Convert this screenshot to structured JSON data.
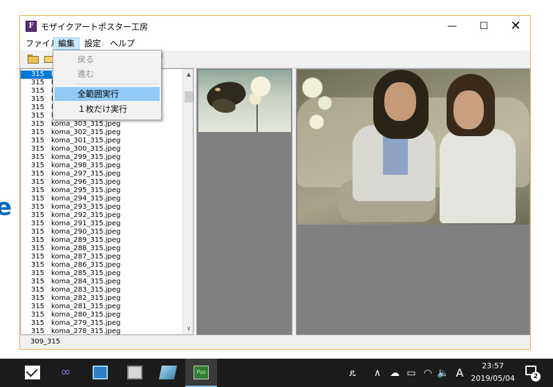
{
  "window": {
    "title": "モザイクアートポスター工房",
    "minimize_glyph": "—",
    "maximize_glyph": "☐",
    "close_glyph": "✕"
  },
  "menubar": {
    "items": [
      {
        "label": "ファイル"
      },
      {
        "label": "編集"
      },
      {
        "label": "設定"
      },
      {
        "label": "ヘルプ"
      }
    ]
  },
  "toolbar": {
    "help_glyph": "?"
  },
  "edit_menu": {
    "items": [
      {
        "label": "戻る",
        "enabled": false
      },
      {
        "label": "進む",
        "enabled": false
      },
      {
        "label": "全範囲実行",
        "enabled": true,
        "highlighted": true
      },
      {
        "label": "１枚だけ実行",
        "enabled": true
      }
    ]
  },
  "file_list": {
    "rows": [
      {
        "num": "315",
        "name": "k"
      },
      {
        "num": "315",
        "name": "k"
      },
      {
        "num": "315",
        "name": "k"
      },
      {
        "num": "315",
        "name": "k"
      },
      {
        "num": "315",
        "name": "k"
      },
      {
        "num": "315",
        "name": "k"
      },
      {
        "num": "315",
        "name": "koma_303_315.jpeg"
      },
      {
        "num": "315",
        "name": "koma_302_315.jpeg"
      },
      {
        "num": "315",
        "name": "koma_301_315.jpeg"
      },
      {
        "num": "315",
        "name": "koma_300_315.jpeg"
      },
      {
        "num": "315",
        "name": "koma_299_315.jpeg"
      },
      {
        "num": "315",
        "name": "koma_298_315.jpeg"
      },
      {
        "num": "315",
        "name": "koma_297_315.jpeg"
      },
      {
        "num": "315",
        "name": "koma_296_315.jpeg"
      },
      {
        "num": "315",
        "name": "koma_295_315.jpeg"
      },
      {
        "num": "315",
        "name": "koma_294_315.jpeg"
      },
      {
        "num": "315",
        "name": "koma_293_315.jpeg"
      },
      {
        "num": "315",
        "name": "koma_292_315.jpeg"
      },
      {
        "num": "315",
        "name": "koma_291_315.jpeg"
      },
      {
        "num": "315",
        "name": "koma_290_315.jpeg"
      },
      {
        "num": "315",
        "name": "koma_289_315.jpeg"
      },
      {
        "num": "315",
        "name": "koma_288_315.jpeg"
      },
      {
        "num": "315",
        "name": "koma_287_315.jpeg"
      },
      {
        "num": "315",
        "name": "koma_286_315.jpeg"
      },
      {
        "num": "315",
        "name": "koma_285_315.jpeg"
      },
      {
        "num": "315",
        "name": "koma_284_315.jpeg"
      },
      {
        "num": "315",
        "name": "koma_283_315.jpeg"
      },
      {
        "num": "315",
        "name": "koma_282_315.jpeg"
      },
      {
        "num": "315",
        "name": "koma_281_315.jpeg"
      },
      {
        "num": "315",
        "name": "koma_280_315.jpeg"
      },
      {
        "num": "315",
        "name": "koma_279_315.jpeg"
      },
      {
        "num": "315",
        "name": "koma_278_315.jpeg"
      }
    ],
    "selected_index": 0,
    "scroll_up_glyph": "▲",
    "scroll_down_glyph": "∨"
  },
  "statusbar": {
    "text": "309_315"
  },
  "taskbar": {
    "apps": [
      {
        "icon": "mail-icon"
      },
      {
        "icon": "loop-app-icon",
        "glyph": "∞"
      },
      {
        "icon": "box-app-icon"
      },
      {
        "icon": "screen-app-icon"
      },
      {
        "icon": "pen-app-icon"
      },
      {
        "icon": "pos-app-icon",
        "glyph": "Pos"
      }
    ],
    "tray": {
      "people_glyph": "ዴ",
      "chevron_glyph": "∧",
      "cloud_glyph": "☁",
      "battery_glyph": "▭",
      "wifi_glyph": "◠",
      "volume_glyph": "🔈",
      "ime_glyph": "A"
    },
    "clock": {
      "time": "23:57",
      "date": "2019/05/04"
    },
    "notification_count": "2"
  },
  "colors": {
    "accent": "#0078d7",
    "menu_highlight": "#91c9f7",
    "window_border": "#e8b44c",
    "taskbar": "#1c1c1c"
  }
}
